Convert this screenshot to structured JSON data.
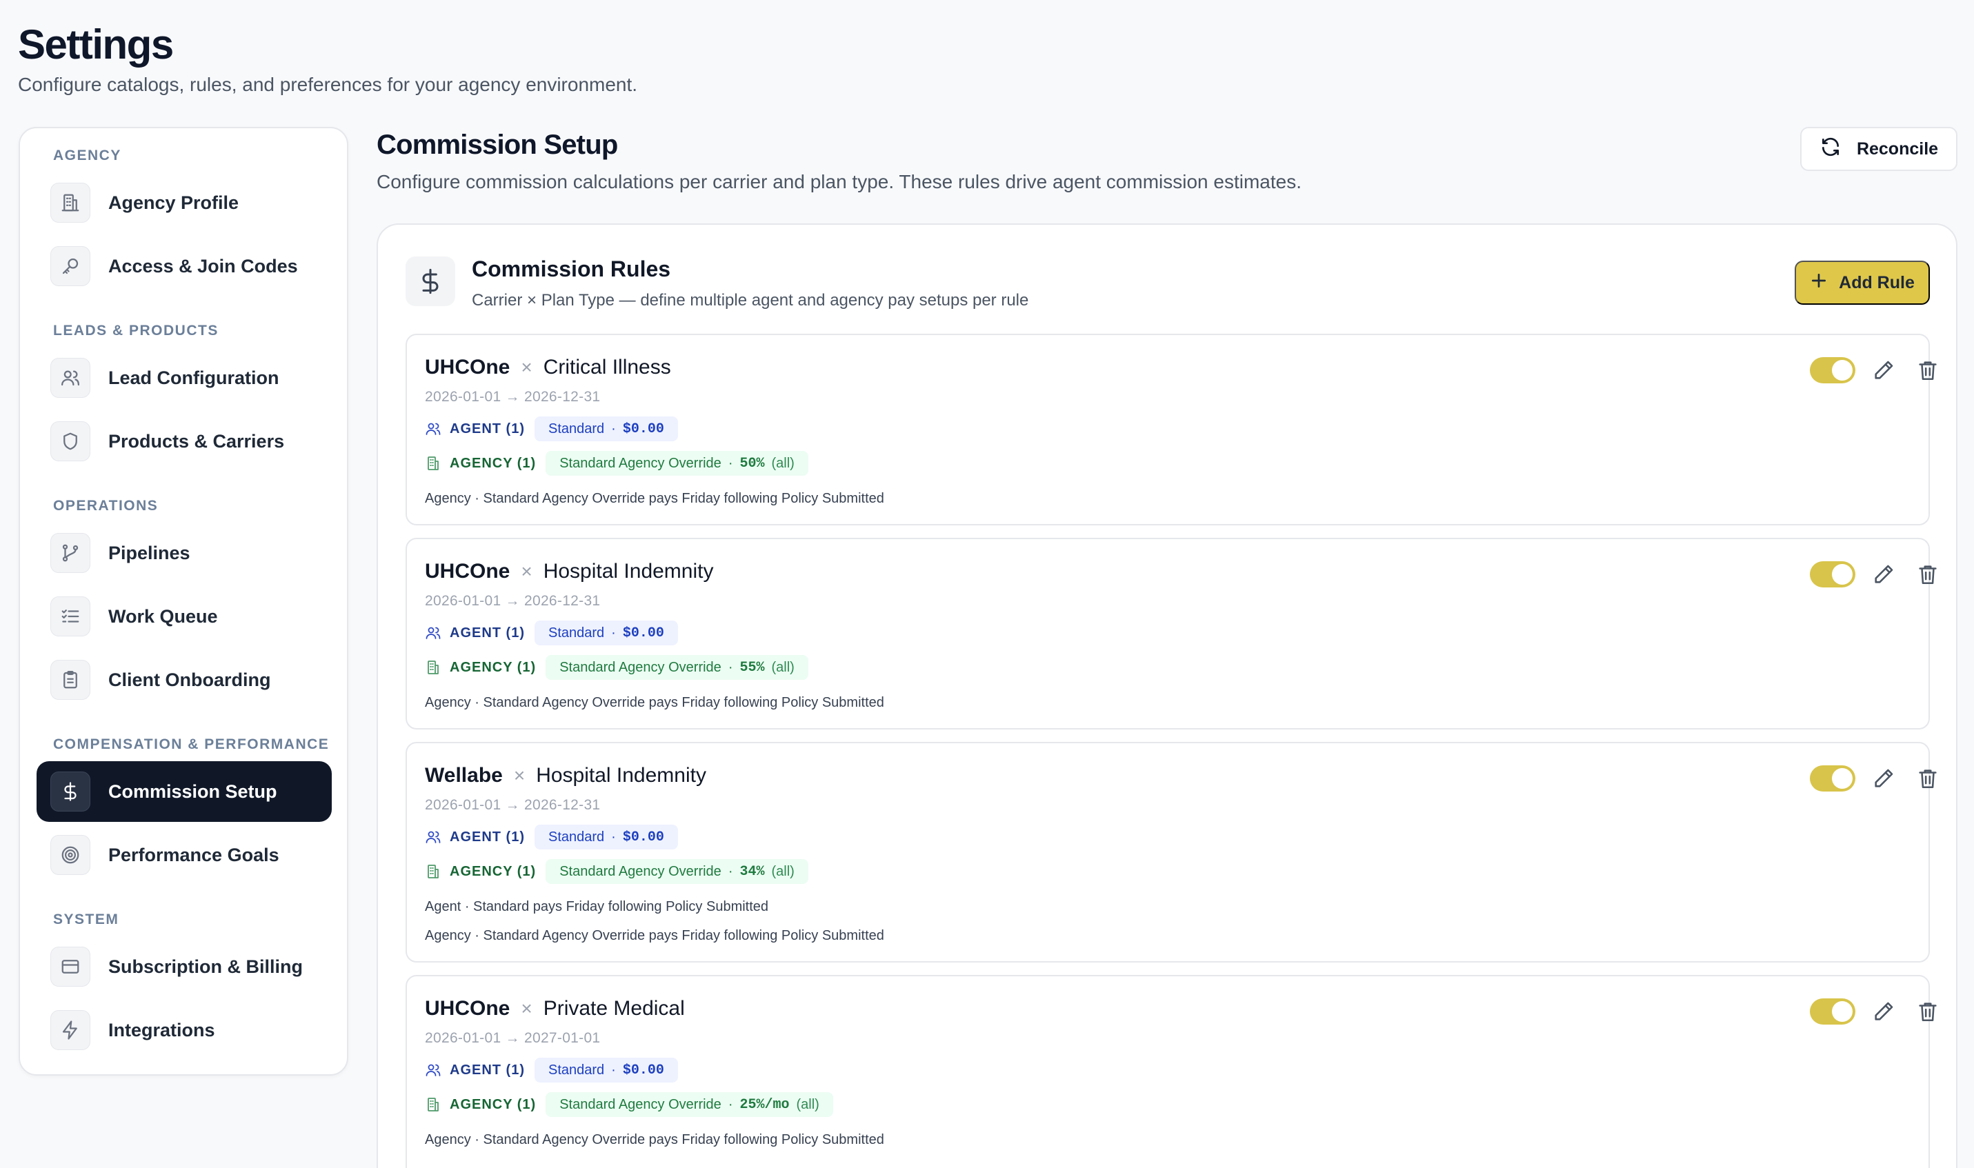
{
  "header": {
    "title": "Settings",
    "subtitle": "Configure catalogs, rules, and preferences for your agency environment."
  },
  "sidebar": {
    "sections": [
      {
        "label": "Agency"
      },
      {
        "label": "Leads & Products"
      },
      {
        "label": "Operations"
      },
      {
        "label": "Compensation & Performance"
      },
      {
        "label": "System"
      }
    ],
    "items": [
      {
        "label": "Agency Profile",
        "icon": "building-icon"
      },
      {
        "label": "Access & Join Codes",
        "icon": "key-icon"
      },
      {
        "label": "Lead Configuration",
        "icon": "users-icon"
      },
      {
        "label": "Products & Carriers",
        "icon": "shield-icon"
      },
      {
        "label": "Pipelines",
        "icon": "git-branch-icon"
      },
      {
        "label": "Work Queue",
        "icon": "list-checks-icon"
      },
      {
        "label": "Client Onboarding",
        "icon": "clipboard-icon"
      },
      {
        "label": "Commission Setup",
        "icon": "dollar-icon",
        "active": true
      },
      {
        "label": "Performance Goals",
        "icon": "target-icon"
      },
      {
        "label": "Subscription & Billing",
        "icon": "credit-card-icon"
      },
      {
        "label": "Integrations",
        "icon": "bolt-icon"
      }
    ]
  },
  "main": {
    "title": "Commission Setup",
    "subtitle": "Configure commission calculations per carrier and plan type. These rules drive agent commission estimates.",
    "reconcile_label": "Reconcile",
    "rules_card": {
      "title": "Commission Rules",
      "subtitle": "Carrier × Plan Type — define multiple agent and agency pay setups per rule",
      "add_rule_label": "Add Rule"
    },
    "rules": [
      {
        "carrier": "UHCOne",
        "separator": "×",
        "plan": "Critical Illness",
        "dates": "2026-01-01 → 2026-12-31",
        "agent_label": "AGENT (1)",
        "agent_setup": "Standard",
        "agent_amount": "$0.00",
        "agency_label": "AGENCY (1)",
        "agency_setup": "Standard Agency Override",
        "agency_amount": "50%",
        "agency_scope": "(all)",
        "agent_note": "",
        "agency_note": "Agency · Standard Agency Override pays Friday following Policy Submitted",
        "enabled": true
      },
      {
        "carrier": "UHCOne",
        "separator": "×",
        "plan": "Hospital Indemnity",
        "dates": "2026-01-01 → 2026-12-31",
        "agent_label": "AGENT (1)",
        "agent_setup": "Standard",
        "agent_amount": "$0.00",
        "agency_label": "AGENCY (1)",
        "agency_setup": "Standard Agency Override",
        "agency_amount": "55%",
        "agency_scope": "(all)",
        "agent_note": "",
        "agency_note": "Agency · Standard Agency Override pays Friday following Policy Submitted",
        "enabled": true
      },
      {
        "carrier": "Wellabe",
        "separator": "×",
        "plan": "Hospital Indemnity",
        "dates": "2026-01-01 → 2026-12-31",
        "agent_label": "AGENT (1)",
        "agent_setup": "Standard",
        "agent_amount": "$0.00",
        "agency_label": "AGENCY (1)",
        "agency_setup": "Standard Agency Override",
        "agency_amount": "34%",
        "agency_scope": "(all)",
        "agent_note": "Agent · Standard pays Friday following Policy Submitted",
        "agency_note": "Agency · Standard Agency Override pays Friday following Policy Submitted",
        "enabled": true
      },
      {
        "carrier": "UHCOne",
        "separator": "×",
        "plan": "Private Medical",
        "dates": "2026-01-01 → 2027-01-01",
        "agent_label": "AGENT (1)",
        "agent_setup": "Standard",
        "agent_amount": "$0.00",
        "agency_label": "AGENCY (1)",
        "agency_setup": "Standard Agency Override",
        "agency_amount": "25%/mo",
        "agency_scope": "(all)",
        "agent_note": "",
        "agency_note": "Agency · Standard Agency Override pays Friday following Policy Submitted",
        "enabled": true
      }
    ]
  },
  "colors": {
    "accent": "#dfc74a",
    "active_nav": "#101828",
    "agent_blue": "#1d3fbf",
    "agency_green": "#1f7a3f"
  }
}
